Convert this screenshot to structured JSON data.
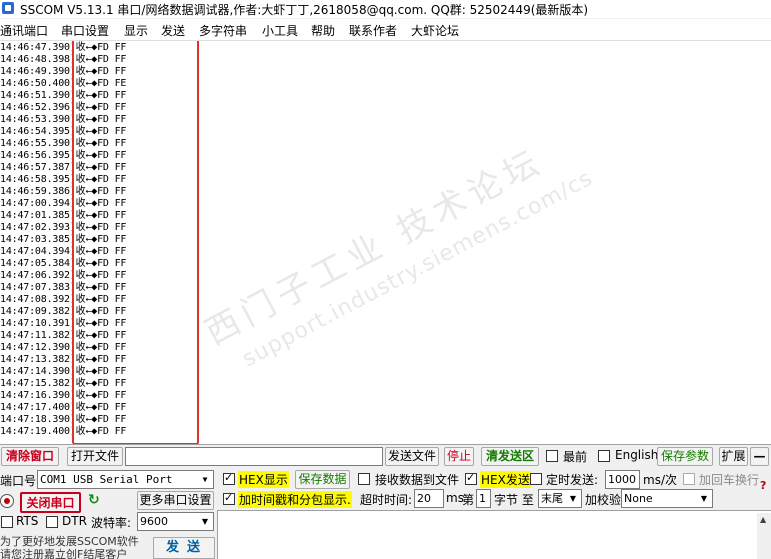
{
  "window": {
    "title": "SSCOM V5.13.1 串口/网络数据调试器,作者:大虾丁丁,2618058@qq.com. QQ群: 52502449(最新版本)"
  },
  "menu": [
    "通讯端口",
    "串口设置",
    "显示",
    "发送",
    "多字符串",
    "小工具",
    "帮助",
    "联系作者",
    "大虾论坛"
  ],
  "log": [
    "14:46:47.390]收←◆FD FF",
    "14:46:48.398]收←◆FD FF",
    "14:46:49.390]收←◆FD FF",
    "14:46:50.400]收←◆FD FE",
    "14:46:51.390]收←◆FD FF",
    "14:46:52.396]收←◆FD FF",
    "14:46:53.390]收←◆FD FF",
    "14:46:54.395]收←◆FD FF",
    "14:46:55.390]收←◆FD FF",
    "14:46:56.395]收←◆FD FF",
    "14:46:57.387]收←◆FD FF",
    "14:46:58.395]收←◆FD FF",
    "14:46:59.386]收←◆FD FF",
    "14:47:00.394]收←◆FD FF",
    "14:47:01.385]收←◆FD FF",
    "14:47:02.393]收←◆FD FF",
    "14:47:03.385]收←◆FD FF",
    "14:47:04.394]收←◆FD FF",
    "14:47:05.384]收←◆FD FF",
    "14:47:06.392]收←◆FD FF",
    "14:47:07.383]收←◆FD FF",
    "14:47:08.392]收←◆FD FF",
    "14:47:09.382]收←◆FD FF",
    "14:47:10.391]收←◆FD FF",
    "14:47:11.382]收←◆FD FF",
    "14:47:12.390]收←◆FD FF",
    "14:47:13.382]收←◆FD FF",
    "14:47:14.390]收←◆FD FF",
    "14:47:15.382]收←◆FD FF",
    "14:47:16.390]收←◆FD FF",
    "14:47:17.400]收←◆FD FF",
    "14:47:18.390]收←◆FD FF",
    "14:47:19.400]收←◆FD FF"
  ],
  "watermark": {
    "line1": "西门子工业 技术论坛",
    "line2": "support.industry.siemens.com/cs"
  },
  "toolbar1": {
    "clear_window": "清除窗口",
    "open_file": "打开文件",
    "file_path": "",
    "send_file": "发送文件",
    "stop": "停止",
    "clear_send": "清发送区",
    "topmost": "最前",
    "english": "English",
    "save_params": "保存参数",
    "expand": "扩展",
    "collapse": "—"
  },
  "port": {
    "port_label": "端口号",
    "port_value": "COM1 USB Serial Port",
    "close_port": "关闭串口",
    "more_settings": "更多串口设置",
    "rts": "RTS",
    "dtr": "DTR",
    "baud_label": "波特率:",
    "baud_value": "9600"
  },
  "options": {
    "hex_display": "HEX显示",
    "save_data": "保存数据",
    "recv_to_file": "接收数据到文件",
    "hex_send": "HEX发送",
    "timed_send": "定时发送:",
    "interval": "1000",
    "interval_unit": "ms/次",
    "add_crlf": "加回车换行",
    "timestamp": "加时间戳和分包显示.",
    "timeout_label": "超时时间:",
    "timeout_value": "20",
    "timeout_unit": "ms",
    "nth_label": "第",
    "nth_value": "1",
    "byte_to": "字节 至",
    "end_value": "末尾",
    "checksum_label": "加校验",
    "checksum_value": "None"
  },
  "send": {
    "button": "发送",
    "promo_line1": "为了更好地发展SSCOM软件",
    "promo_line2": "请您注册嘉立创F结尾客户"
  }
}
